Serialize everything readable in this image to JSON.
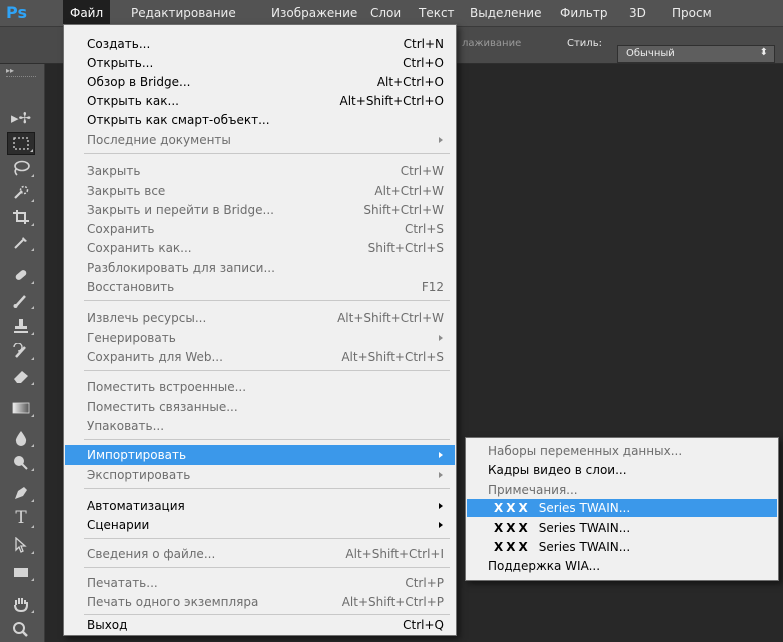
{
  "app": {
    "logo": "Ps"
  },
  "menubar": {
    "items": [
      {
        "label": "Файл"
      },
      {
        "label": "Редактирование"
      },
      {
        "label": "Изображение"
      },
      {
        "label": "Слои"
      },
      {
        "label": "Текст"
      },
      {
        "label": "Выделение"
      },
      {
        "label": "Фильтр"
      },
      {
        "label": "3D"
      },
      {
        "label": "Просм"
      }
    ]
  },
  "options_bar": {
    "partial_text": "лаживание",
    "style_label": "Стиль:",
    "style_value": "Обычный"
  },
  "tools": [
    {
      "icon": "move-tool-icon"
    },
    {
      "icon": "rect-marquee-tool-icon",
      "selected": true
    },
    {
      "icon": "lasso-tool-icon"
    },
    {
      "icon": "quick-selection-tool-icon"
    },
    {
      "icon": "crop-tool-icon"
    },
    {
      "icon": "eyedropper-tool-icon"
    },
    {
      "icon": "healing-brush-tool-icon"
    },
    {
      "icon": "brush-tool-icon"
    },
    {
      "icon": "clone-stamp-tool-icon"
    },
    {
      "icon": "history-brush-tool-icon"
    },
    {
      "icon": "eraser-tool-icon"
    },
    {
      "icon": "gradient-tool-icon"
    },
    {
      "icon": "blur-tool-icon"
    },
    {
      "icon": "dodge-tool-icon"
    },
    {
      "icon": "pen-tool-icon"
    },
    {
      "icon": "type-tool-icon"
    },
    {
      "icon": "path-selection-tool-icon"
    },
    {
      "icon": "rectangle-shape-tool-icon"
    },
    {
      "icon": "hand-tool-icon"
    },
    {
      "icon": "zoom-tool-icon"
    }
  ],
  "file_menu": {
    "items": [
      {
        "label": "Создать...",
        "shortcut": "Ctrl+N"
      },
      {
        "label": "Открыть...",
        "shortcut": "Ctrl+O"
      },
      {
        "label": "Обзор в Bridge...",
        "shortcut": "Alt+Ctrl+O"
      },
      {
        "label": "Открыть как...",
        "shortcut": "Alt+Shift+Ctrl+O"
      },
      {
        "label": "Открыть как смарт-объект..."
      },
      {
        "label": "Последние документы",
        "disabled": true,
        "submenu": true
      },
      {
        "label": "Закрыть",
        "shortcut": "Ctrl+W",
        "disabled": true
      },
      {
        "label": "Закрыть все",
        "shortcut": "Alt+Ctrl+W",
        "disabled": true
      },
      {
        "label": "Закрыть и перейти в Bridge...",
        "shortcut": "Shift+Ctrl+W",
        "disabled": true
      },
      {
        "label": "Сохранить",
        "shortcut": "Ctrl+S",
        "disabled": true
      },
      {
        "label": "Сохранить как...",
        "shortcut": "Shift+Ctrl+S",
        "disabled": true
      },
      {
        "label": "Разблокировать для записи...",
        "disabled": true
      },
      {
        "label": "Восстановить",
        "shortcut": "F12",
        "disabled": true
      },
      {
        "label": "Извлечь ресурсы...",
        "shortcut": "Alt+Shift+Ctrl+W",
        "disabled": true
      },
      {
        "label": "Генерировать",
        "disabled": true,
        "submenu": true
      },
      {
        "label": "Сохранить для Web...",
        "shortcut": "Alt+Shift+Ctrl+S",
        "disabled": true
      },
      {
        "label": "Поместить встроенные...",
        "disabled": true
      },
      {
        "label": "Поместить связанные...",
        "disabled": true
      },
      {
        "label": "Упаковать...",
        "disabled": true
      },
      {
        "label": "Импортировать",
        "submenu": true,
        "highlighted": true
      },
      {
        "label": "Экспортировать",
        "disabled": true,
        "submenu": true
      },
      {
        "label": "Автоматизация",
        "submenu": true
      },
      {
        "label": "Сценарии",
        "submenu": true
      },
      {
        "label": "Сведения о файле...",
        "shortcut": "Alt+Shift+Ctrl+I",
        "disabled": true
      },
      {
        "label": "Печатать...",
        "shortcut": "Ctrl+P",
        "disabled": true
      },
      {
        "label": "Печать одного экземпляра",
        "shortcut": "Alt+Shift+Ctrl+P",
        "disabled": true
      },
      {
        "label": "Выход",
        "shortcut": "Ctrl+Q"
      }
    ]
  },
  "import_submenu": {
    "items": [
      {
        "label": "Наборы переменных данных...",
        "disabled": true
      },
      {
        "label": "Кадры видео в слои..."
      },
      {
        "label": "Примечания...",
        "disabled": true
      },
      {
        "prefix": "XXX",
        "label": "Series TWAIN...",
        "highlighted": true
      },
      {
        "prefix": "XXX",
        "label": "Series TWAIN..."
      },
      {
        "prefix": "XXX",
        "label": "Series TWAIN..."
      },
      {
        "label": "Поддержка WIA..."
      }
    ]
  },
  "colors": {
    "menu_bg": "#f0f0f0",
    "highlight": "#3b98ea",
    "ui_dark": "#535353",
    "ps_blue": "#2fa3f6"
  }
}
